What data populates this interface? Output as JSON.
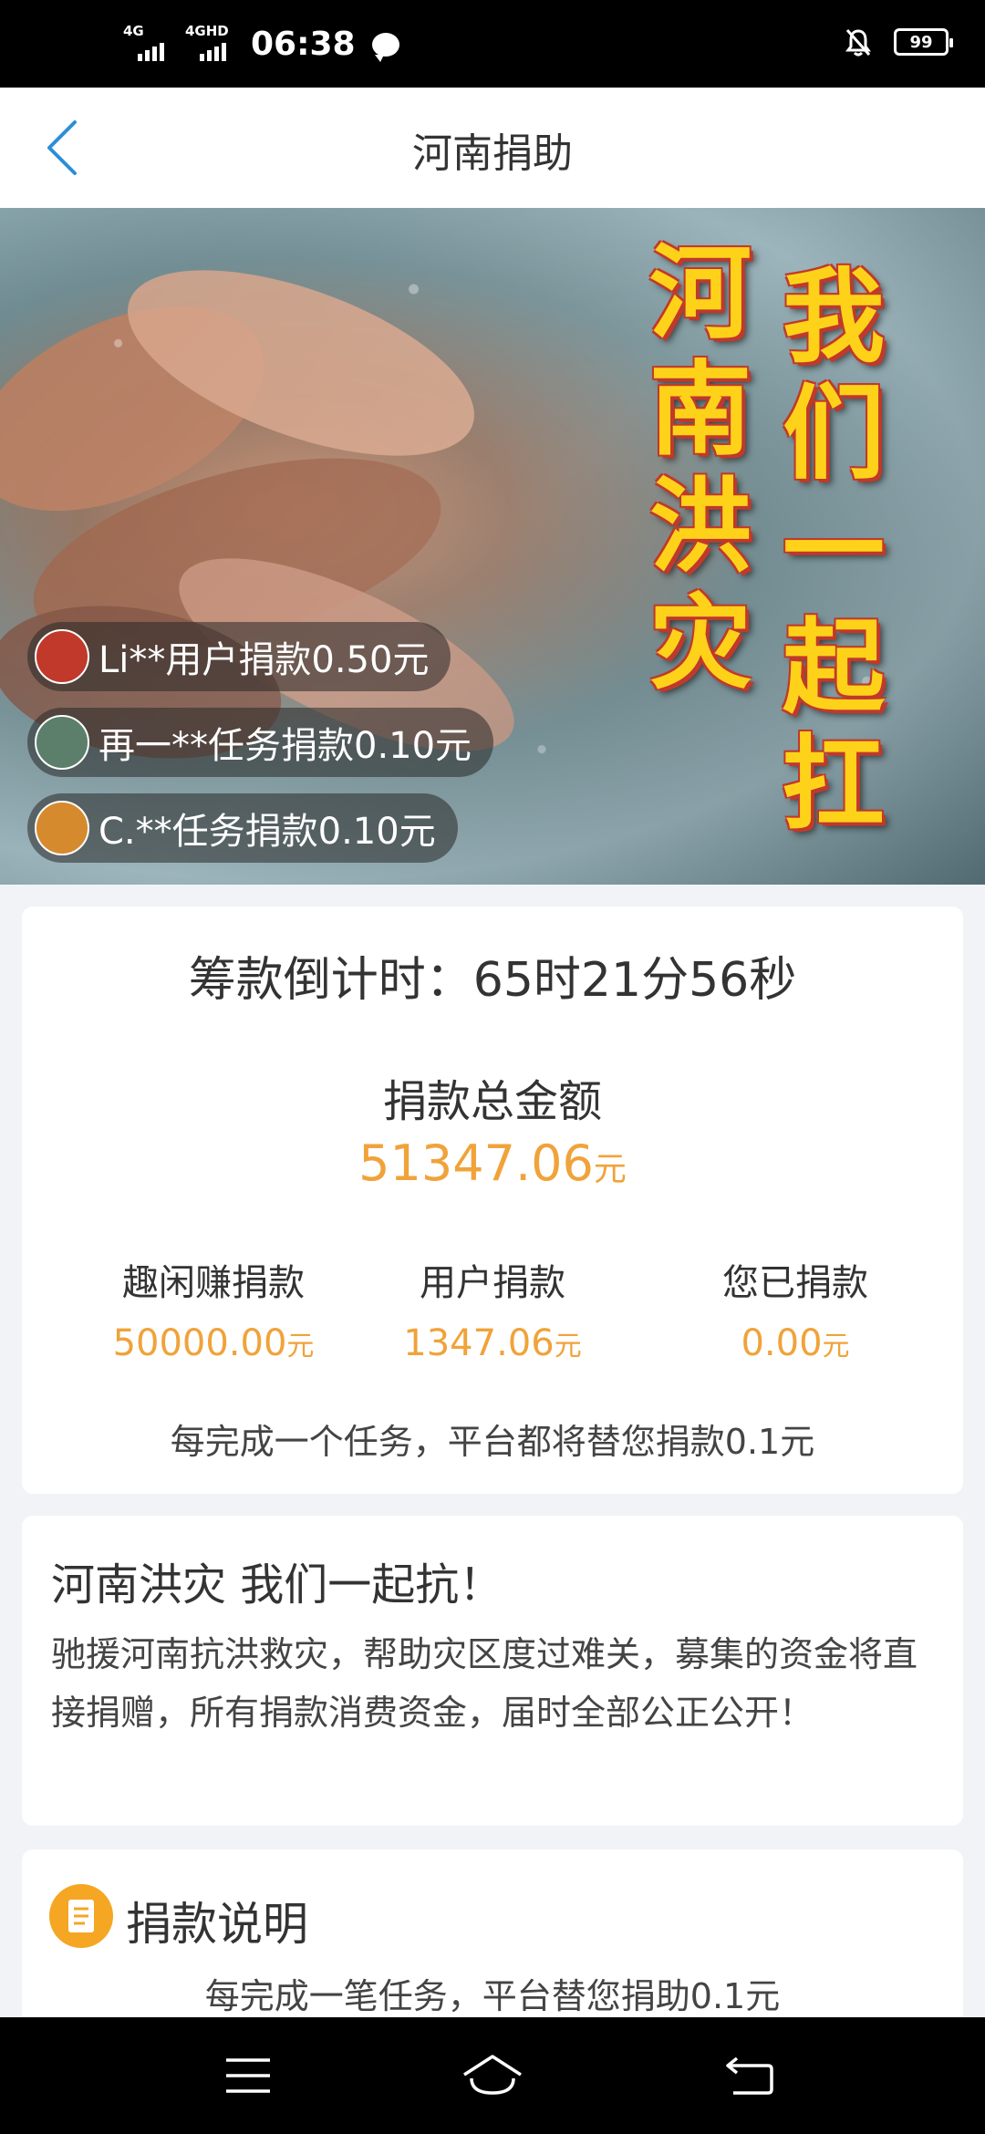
{
  "status_bar": {
    "network_1": "4G",
    "network_2": "4GHD",
    "time": "06:38",
    "battery": "99",
    "icons": [
      "chat-bubble-icon",
      "mute-bell-icon",
      "battery-icon"
    ]
  },
  "nav": {
    "title": "河南捐助",
    "back_icon": "chevron-left-icon"
  },
  "banner": {
    "left_column": [
      "河",
      "南",
      "洪",
      "灾"
    ],
    "right_column": [
      "我",
      "们",
      "一",
      "起",
      "扛"
    ],
    "ticker": [
      {
        "text": "Li**用户捐款0.50元",
        "avatar_color": "#c0392b"
      },
      {
        "text": "再一**任务捐款0.10元",
        "avatar_color": "#5b7f6a"
      },
      {
        "text": "C.**任务捐款0.10元",
        "avatar_color": "#d68a2e"
      }
    ]
  },
  "summary": {
    "countdown": "筹款倒计时：65时21分56秒",
    "total_label": "捐款总金额",
    "total_value": "51347.06",
    "total_unit": "元",
    "stats": [
      {
        "label": "趣闲赚捐款",
        "value": "50000.00",
        "unit": "元"
      },
      {
        "label": "用户捐款",
        "value": "1347.06",
        "unit": "元"
      },
      {
        "label": "您已捐款",
        "value": "0.00",
        "unit": "元"
      }
    ],
    "note": "每完成一个任务，平台都将替您捐款0.1元"
  },
  "appeal": {
    "title": "河南洪灾 我们一起抗！",
    "body": "驰援河南抗洪救灾，帮助灾区度过难关，募集的资金将直接捐赠，所有捐款消费资金，届时全部公正公开！"
  },
  "info": {
    "icon": "document-icon",
    "title": "捐款说明",
    "text": "每完成一笔任务，平台替您捐助0.1元"
  },
  "system_nav": {
    "icons": [
      "menu-icon",
      "home-icon",
      "back-icon"
    ]
  },
  "colors": {
    "accent": "#f0a33a",
    "link_blue": "#2b8fd8",
    "banner_text": "#ffd21a"
  }
}
